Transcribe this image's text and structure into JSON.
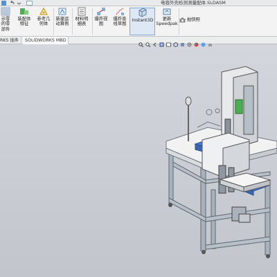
{
  "window": {
    "document_title": "电容外壳检测测量配体.SLDASM"
  },
  "ribbon": {
    "buttons": [
      {
        "id": "smart",
        "label": "示零\n的零\n部件",
        "icon": "component-icon"
      },
      {
        "id": "assembly",
        "label": "装配体\n特征",
        "icon": "assembly-feature-icon"
      },
      {
        "id": "reference",
        "label": "参考几\n何体",
        "icon": "reference-geometry-icon"
      },
      {
        "id": "motion",
        "label": "新建运\n动算例",
        "icon": "motion-study-icon"
      },
      {
        "id": "bom",
        "label": "材料明\n细表",
        "icon": "bom-icon"
      },
      {
        "id": "explode",
        "label": "爆炸视\n图",
        "icon": "exploded-view-icon"
      },
      {
        "id": "explode-line",
        "label": "爆炸直\n线草图",
        "icon": "explode-line-icon"
      },
      {
        "id": "instant3d",
        "label": "Instant3D",
        "icon": "instant3d-icon"
      },
      {
        "id": "speedpak",
        "label": "更新\nSpeedpak",
        "icon": "speedpak-icon"
      },
      {
        "id": "snapshot",
        "label": "拍快照",
        "icon": "camera-icon"
      }
    ]
  },
  "tabs": [
    {
      "label": "RKS 插件",
      "active": false
    },
    {
      "label": "SOLIDWORKS MBD",
      "active": false
    }
  ],
  "colors": {
    "accent": "#3a7fc9",
    "frame": "#9aa3ad",
    "tabletop": "#f2f2f2",
    "blue_part": "#4a7fd6",
    "green_part": "#4caf50"
  }
}
